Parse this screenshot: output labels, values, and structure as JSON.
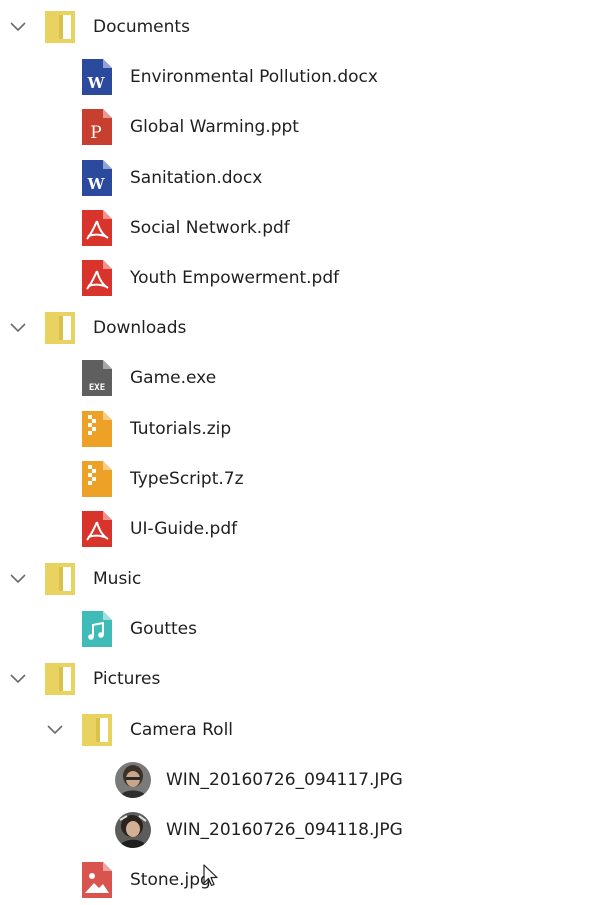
{
  "tree": {
    "folders": [
      {
        "name": "Documents",
        "expanded": true,
        "children": [
          {
            "name": "Environmental Pollution.docx",
            "icon": "word-doc-icon"
          },
          {
            "name": "Global Warming.ppt",
            "icon": "powerpoint-icon"
          },
          {
            "name": "Sanitation.docx",
            "icon": "word-doc-icon"
          },
          {
            "name": "Social Network.pdf",
            "icon": "pdf-icon"
          },
          {
            "name": "Youth Empowerment.pdf",
            "icon": "pdf-icon"
          }
        ]
      },
      {
        "name": "Downloads",
        "expanded": true,
        "children": [
          {
            "name": "Game.exe",
            "icon": "exe-icon"
          },
          {
            "name": "Tutorials.zip",
            "icon": "zip-icon"
          },
          {
            "name": "TypeScript.7z",
            "icon": "zip-icon"
          },
          {
            "name": "UI-Guide.pdf",
            "icon": "pdf-icon"
          }
        ]
      },
      {
        "name": "Music",
        "expanded": true,
        "children": [
          {
            "name": "Gouttes",
            "icon": "music-icon"
          }
        ]
      },
      {
        "name": "Pictures",
        "expanded": true,
        "children": [
          {
            "name": "Camera Roll",
            "expanded": true,
            "children": [
              {
                "name": "WIN_20160726_094117.JPG",
                "icon": "photo-thumbnail-icon"
              },
              {
                "name": "WIN_20160726_094118.JPG",
                "icon": "photo-thumbnail-icon"
              }
            ]
          },
          {
            "name": "Stone.jpg",
            "icon": "image-icon"
          }
        ]
      }
    ]
  },
  "colors": {
    "folder": "#e8d361",
    "folder_dark": "#d9c24a",
    "word": "#2b4a9e",
    "powerpoint": "#c7402f",
    "pdf": "#d9342b",
    "exe": "#5f5f5f",
    "zip": "#eea127",
    "music": "#3fbcb7",
    "image": "#d9534f",
    "chevron": "#6b6b6b"
  }
}
